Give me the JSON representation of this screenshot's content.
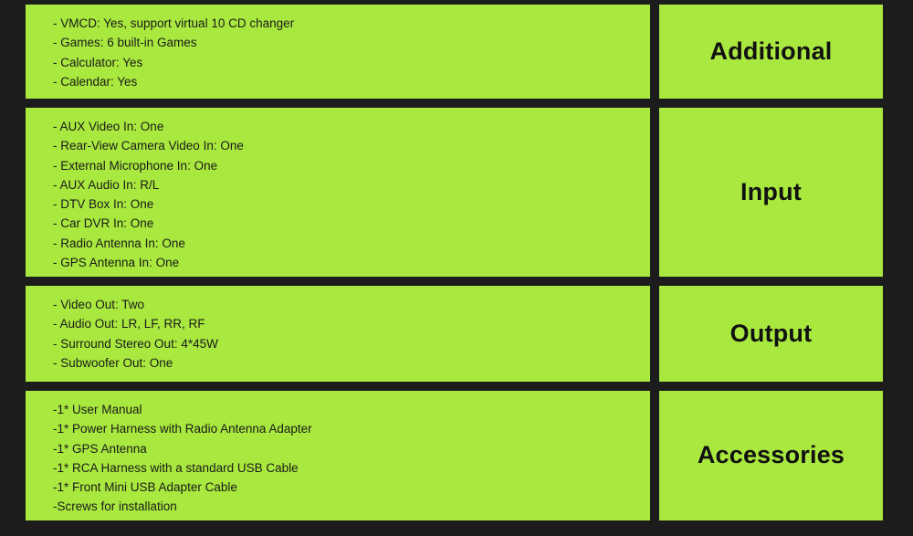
{
  "colors": {
    "panel_green": "#a9e83e",
    "background_dark": "#1c1c1c",
    "text_dark": "#1a1a1a"
  },
  "sections": [
    {
      "label": "Additional",
      "items": [
        "- VMCD: Yes, support virtual 10 CD changer",
        "- Games: 6 built-in Games",
        "- Calculator: Yes",
        "- Calendar: Yes"
      ]
    },
    {
      "label": "Input",
      "items": [
        "- AUX Video In: One",
        "- Rear-View Camera Video In: One",
        "- External Microphone In: One",
        "- AUX Audio In: R/L",
        "- DTV Box In: One",
        "- Car DVR In: One",
        "- Radio Antenna In: One",
        "- GPS Antenna In: One"
      ]
    },
    {
      "label": "Output",
      "items": [
        "- Video Out: Two",
        "- Audio Out: LR, LF, RR, RF",
        "- Surround Stereo Out: 4*45W",
        "- Subwoofer Out: One"
      ]
    },
    {
      "label": "Accessories",
      "items": [
        "-1* User Manual",
        "-1* Power Harness with Radio Antenna Adapter",
        "-1* GPS Antenna",
        "-1* RCA Harness with a standard USB Cable",
        "-1* Front Mini USB Adapter Cable",
        "-Screws for installation"
      ]
    }
  ]
}
